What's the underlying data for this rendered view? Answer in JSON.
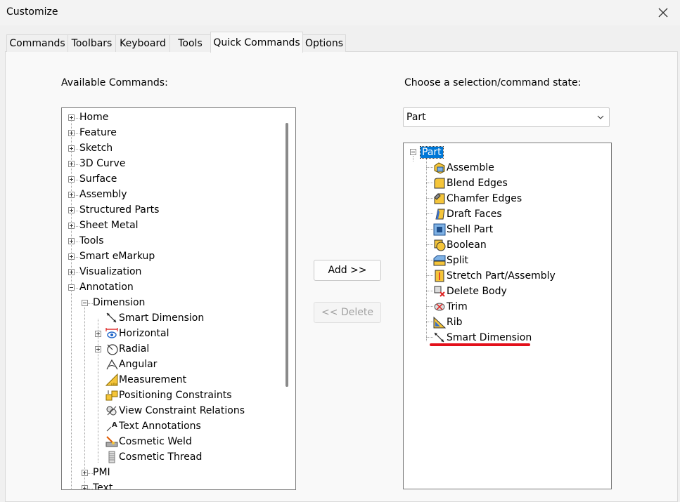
{
  "window": {
    "title": "Customize"
  },
  "tabs": [
    {
      "label": "Commands",
      "active": false
    },
    {
      "label": "Toolbars",
      "active": false
    },
    {
      "label": "Keyboard",
      "active": false
    },
    {
      "label": "Tools",
      "active": false
    },
    {
      "label": "Quick Commands",
      "active": true
    },
    {
      "label": "Options",
      "active": false
    }
  ],
  "left": {
    "label": "Available Commands:",
    "items": [
      {
        "label": "Home"
      },
      {
        "label": "Feature"
      },
      {
        "label": "Sketch"
      },
      {
        "label": "3D Curve"
      },
      {
        "label": "Surface"
      },
      {
        "label": "Assembly"
      },
      {
        "label": "Structured Parts"
      },
      {
        "label": "Sheet Metal"
      },
      {
        "label": "Tools"
      },
      {
        "label": "Smart eMarkup"
      },
      {
        "label": "Visualization"
      },
      {
        "label": "Annotation"
      },
      {
        "label": "Dimension"
      },
      {
        "label": "Smart Dimension",
        "icon": "smart-dimension-icon"
      },
      {
        "label": "Horizontal",
        "icon": "horizontal-dimension-icon"
      },
      {
        "label": "Radial",
        "icon": "radial-dimension-icon"
      },
      {
        "label": "Angular",
        "icon": "angular-dimension-icon"
      },
      {
        "label": "Measurement",
        "icon": "measurement-icon"
      },
      {
        "label": "Positioning Constraints",
        "icon": "positioning-constraints-icon"
      },
      {
        "label": "View Constraint Relations",
        "icon": "view-constraint-relations-icon"
      },
      {
        "label": "Text Annotations",
        "icon": "text-annotations-icon"
      },
      {
        "label": "Cosmetic Weld",
        "icon": "cosmetic-weld-icon"
      },
      {
        "label": "Cosmetic Thread",
        "icon": "cosmetic-thread-icon"
      },
      {
        "label": "PMI"
      },
      {
        "label": "Text"
      }
    ]
  },
  "buttons": {
    "add": "Add >>",
    "delete": "<< Delete"
  },
  "right": {
    "label": "Choose a selection/command state:",
    "dropdown_value": "Part",
    "root": "Part",
    "items": [
      {
        "label": "Assemble",
        "icon": "assemble-icon"
      },
      {
        "label": "Blend Edges",
        "icon": "blend-edges-icon"
      },
      {
        "label": "Chamfer Edges",
        "icon": "chamfer-edges-icon"
      },
      {
        "label": "Draft Faces",
        "icon": "draft-faces-icon"
      },
      {
        "label": "Shell Part",
        "icon": "shell-part-icon"
      },
      {
        "label": "Boolean",
        "icon": "boolean-icon"
      },
      {
        "label": "Split",
        "icon": "split-icon"
      },
      {
        "label": "Stretch Part/Assembly",
        "icon": "stretch-icon"
      },
      {
        "label": "Delete Body",
        "icon": "delete-body-icon"
      },
      {
        "label": "Trim",
        "icon": "trim-icon"
      },
      {
        "label": "Rib",
        "icon": "rib-icon"
      },
      {
        "label": "Smart Dimension",
        "icon": "smart-dimension-icon"
      }
    ]
  },
  "colors": {
    "highlight": "#0078d7",
    "underline": "#e3101a",
    "part_yellow": "#f5c53a"
  }
}
